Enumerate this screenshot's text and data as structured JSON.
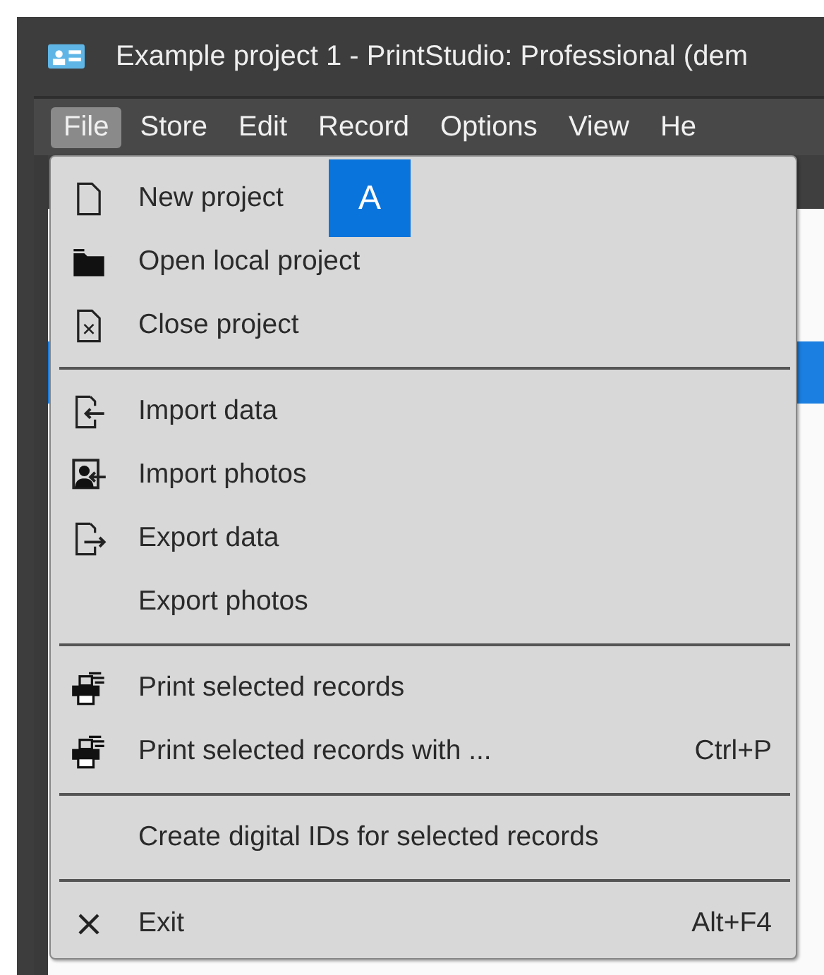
{
  "window": {
    "title": "Example project 1 - PrintStudio: Professional (dem"
  },
  "menubar": [
    {
      "label": "File",
      "selected": true
    },
    {
      "label": "Store",
      "selected": false
    },
    {
      "label": "Edit",
      "selected": false
    },
    {
      "label": "Record",
      "selected": false
    },
    {
      "label": "Options",
      "selected": false
    },
    {
      "label": "View",
      "selected": false
    },
    {
      "label": "He",
      "selected": false
    }
  ],
  "file_menu": {
    "sections": [
      {
        "items": [
          {
            "label": "New project",
            "kind": "page"
          },
          {
            "label": "Open local project",
            "kind": "folder"
          },
          {
            "label": "Close project",
            "kind": "closepage"
          }
        ]
      },
      {
        "items": [
          {
            "label": "Import data",
            "kind": "importpage"
          },
          {
            "label": "Import photos",
            "kind": "importphoto"
          },
          {
            "label": "Export data",
            "kind": "exportpage"
          },
          {
            "label": "Export photos",
            "kind": "plain"
          }
        ]
      },
      {
        "items": [
          {
            "label": "Print selected records",
            "kind": "print"
          },
          {
            "label": "Print selected records with ...",
            "kind": "print",
            "shortcut": "Ctrl+P"
          }
        ]
      },
      {
        "items": [
          {
            "label": "Create digital IDs for selected records",
            "kind": "plain"
          }
        ]
      },
      {
        "items": [
          {
            "label": "Exit",
            "kind": "exit",
            "shortcut": "Alt+F4"
          }
        ]
      }
    ]
  },
  "callout": {
    "label": "A"
  }
}
